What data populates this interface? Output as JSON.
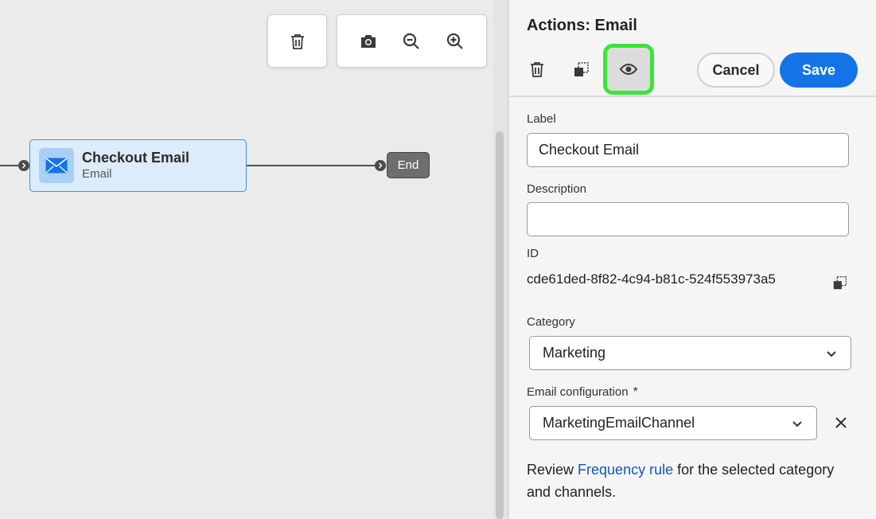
{
  "canvas": {
    "node": {
      "title": "Checkout Email",
      "subtitle": "Email",
      "icon": "envelope-icon"
    },
    "end_node": {
      "label": "End"
    },
    "toolbar": {
      "delete_icon": "trash-icon",
      "screenshot_icon": "camera-icon",
      "zoom_out_icon": "zoom-out-icon",
      "zoom_in_icon": "zoom-in-icon"
    }
  },
  "panel": {
    "title": "Actions: Email",
    "cancel_label": "Cancel",
    "save_label": "Save",
    "fields": {
      "label_label": "Label",
      "label_value": "Checkout Email",
      "description_label": "Description",
      "description_value": "",
      "id_label": "ID",
      "id_value": "cde61ded-8f82-4c94-b81c-524f553973a5",
      "category_label": "Category",
      "category_value": "Marketing",
      "email_config_label": "Email configuration",
      "email_config_required": "*",
      "email_config_value": "MarketingEmailChannel"
    },
    "review": {
      "prefix": "Review ",
      "link": "Frequency rule",
      "suffix": " for the selected category and channels."
    }
  },
  "colors": {
    "accent": "#1473e6",
    "highlight": "#39e53a",
    "node_bg": "#dcecfb",
    "link": "#1358b8"
  }
}
